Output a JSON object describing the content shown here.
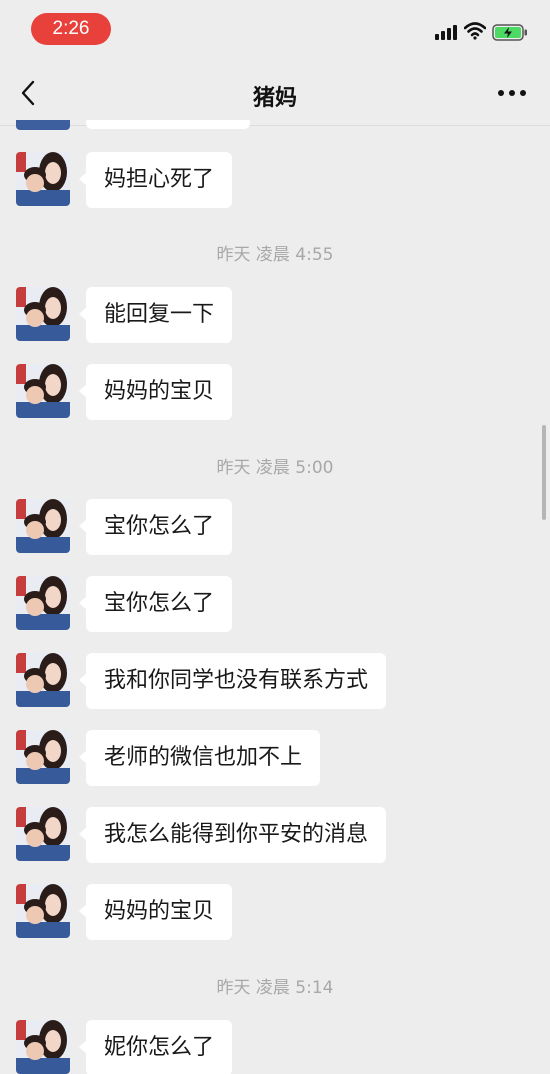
{
  "status_bar": {
    "time": "2:26"
  },
  "nav": {
    "title": "猪妈",
    "back_icon": "chevron-left-icon",
    "more_icon": "ellipsis-icon"
  },
  "timestamps": {
    "t1": "昨天 凌晨 4:55",
    "t2": "昨天 凌晨 5:00",
    "t3": "昨天 凌晨 5:14"
  },
  "messages": [
    {
      "text": "妈担心死了"
    },
    {
      "text": "能回复一下"
    },
    {
      "text": "妈妈的宝贝"
    },
    {
      "text": "宝你怎么了"
    },
    {
      "text": "宝你怎么了"
    },
    {
      "text": "我和你同学也没有联系方式"
    },
    {
      "text": "老师的微信也加不上"
    },
    {
      "text": "我怎么能得到你平安的消息"
    },
    {
      "text": "妈妈的宝贝"
    },
    {
      "text": "妮你怎么了"
    }
  ],
  "colors": {
    "background": "#ededed",
    "bubble": "#ffffff",
    "time_pill": "#e8413c",
    "battery_charge": "#4cd964"
  }
}
